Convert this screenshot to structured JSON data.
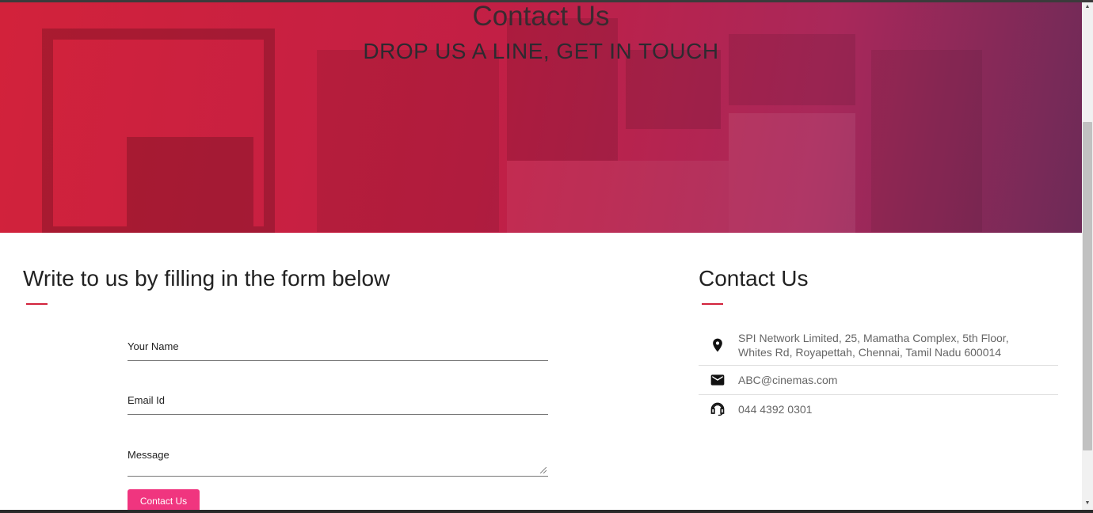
{
  "hero": {
    "title": "Contact Us",
    "subtitle": "DROP US A LINE, GET IN TOUCH"
  },
  "form": {
    "heading": "Write to us by filling in the form below",
    "name_label": "Your Name",
    "email_label": "Email Id",
    "message_label": "Message",
    "submit_label": "Contact Us"
  },
  "contact": {
    "heading": "Contact Us",
    "address_line1": "SPI Network Limited, 25, Mamatha Complex, 5th Floor,",
    "address_line2": "Whites Rd, Royapettah, Chennai, Tamil Nadu 600014",
    "email": "ABC@cinemas.com",
    "phone": "044 4392 0301"
  },
  "icons": {
    "address": "location-pin-icon",
    "email": "envelope-icon",
    "phone": "headset-icon"
  },
  "colors": {
    "accent": "#d2223b",
    "button": "#f0357f",
    "hero_start": "#d2223b",
    "hero_end": "#6d2a57"
  }
}
